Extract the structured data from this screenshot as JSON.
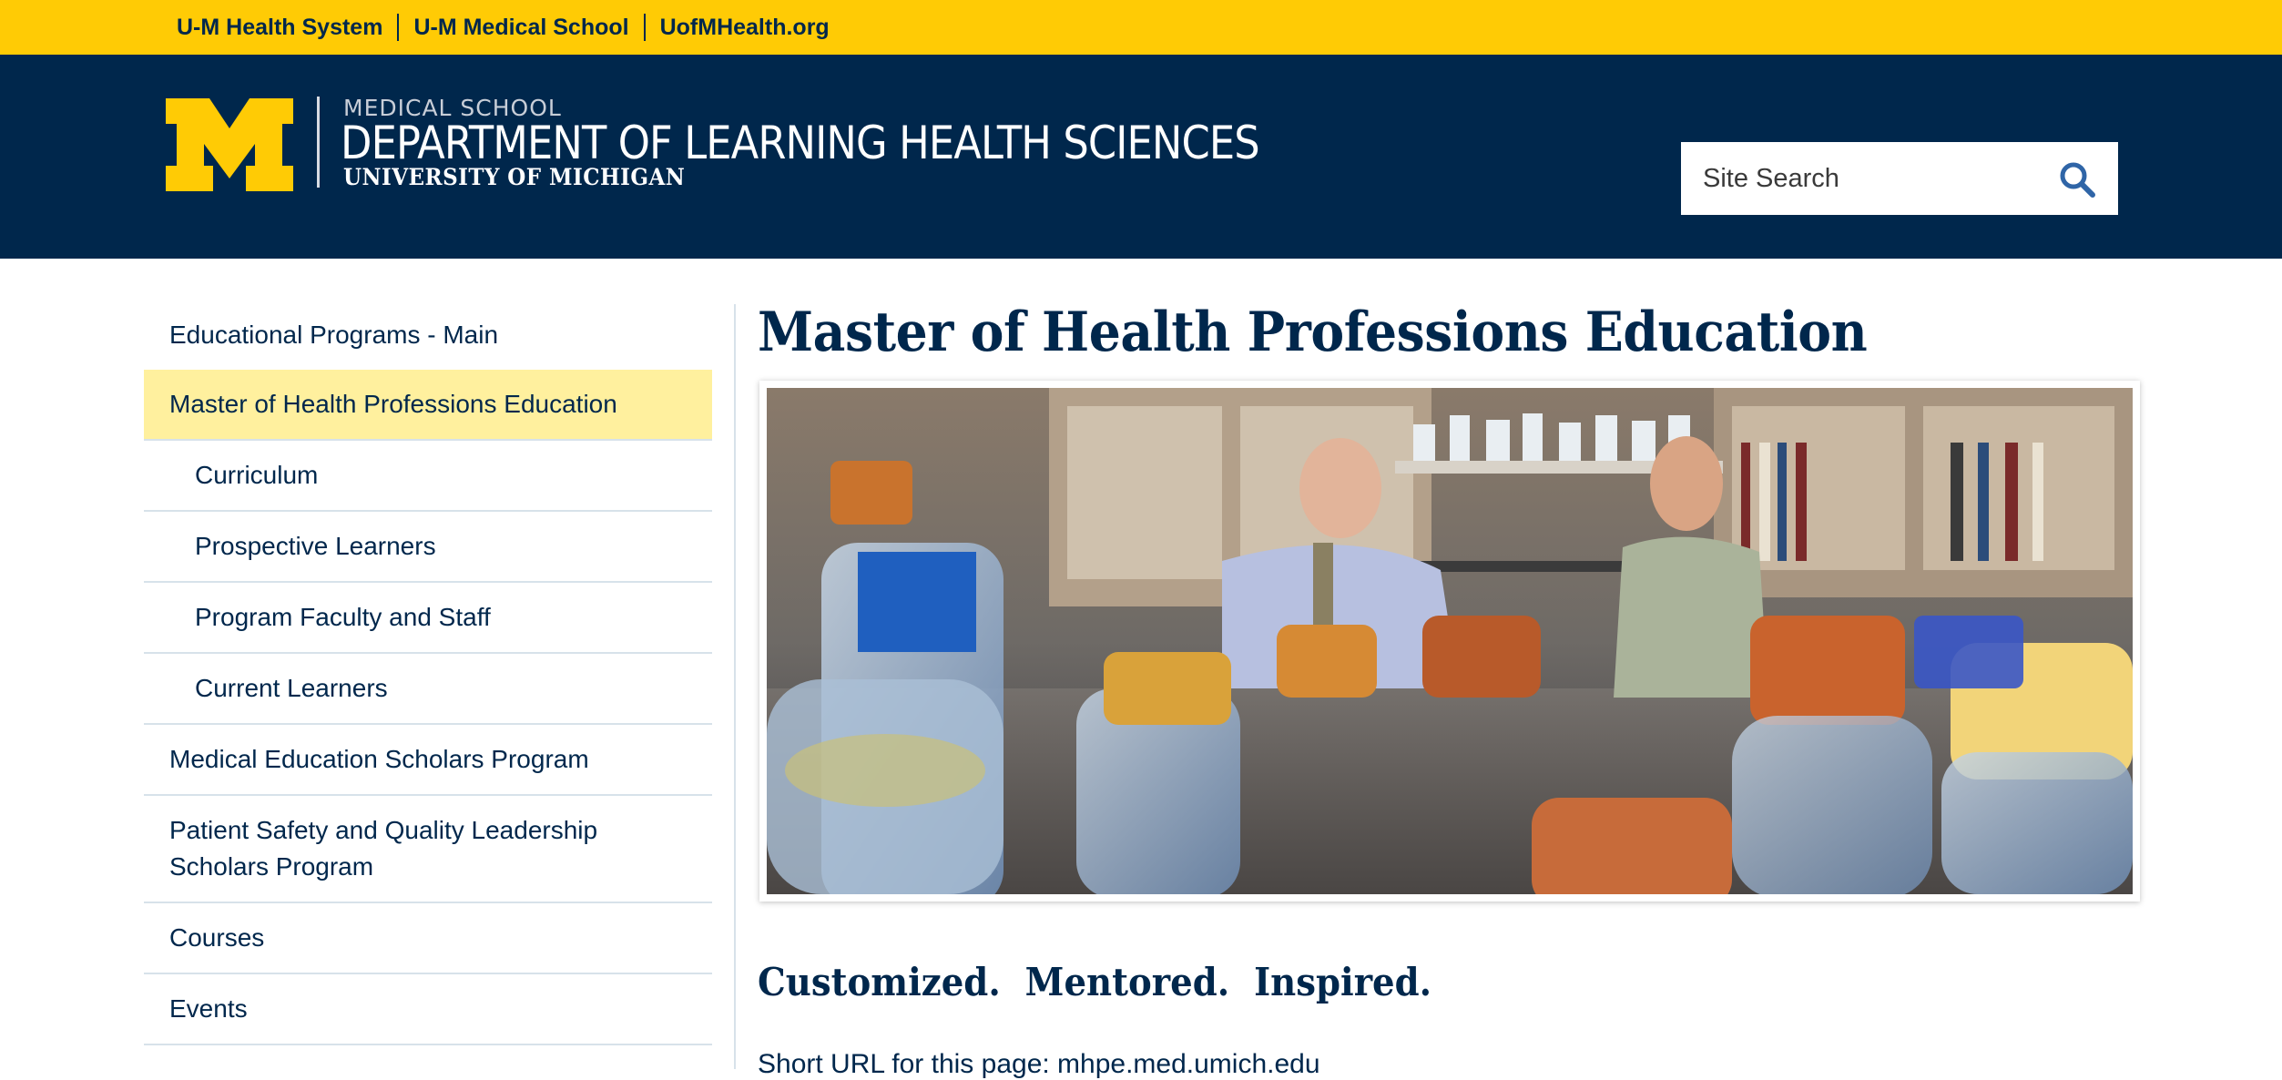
{
  "utility_bar": {
    "links": [
      "U-M Health System",
      "U-M Medical School",
      "UofMHealth.org"
    ],
    "background": "#ffcb05"
  },
  "header": {
    "logo": {
      "kicker": "MEDICAL SCHOOL",
      "department": "DEPARTMENT OF LEARNING HEALTH SCIENCES",
      "university": "UNIVERSITY OF MICHIGAN",
      "mark_icon": "block-m-icon"
    },
    "search": {
      "placeholder": "Site Search",
      "icon": "search-icon"
    },
    "background": "#00274c"
  },
  "sidebar": {
    "items": [
      {
        "label": "Educational Programs - Main"
      },
      {
        "label": "Master of Health Professions Education",
        "active": true
      },
      {
        "label": "Curriculum"
      },
      {
        "label": "Prospective Learners"
      },
      {
        "label": "Program Faculty and Staff"
      },
      {
        "label": "Current Learners"
      },
      {
        "label": "Medical Education Scholars Program"
      },
      {
        "label": "Patient Safety and Quality Leadership Scholars Program"
      },
      {
        "label": "Courses"
      },
      {
        "label": "Events"
      }
    ],
    "active_color": "#fff09e"
  },
  "main": {
    "title": "Master of Health Professions Education",
    "tagline": "Customized.  Mentored.  Inspired.",
    "short_url": "Short URL for this page: mhpe.med.umich.edu"
  }
}
